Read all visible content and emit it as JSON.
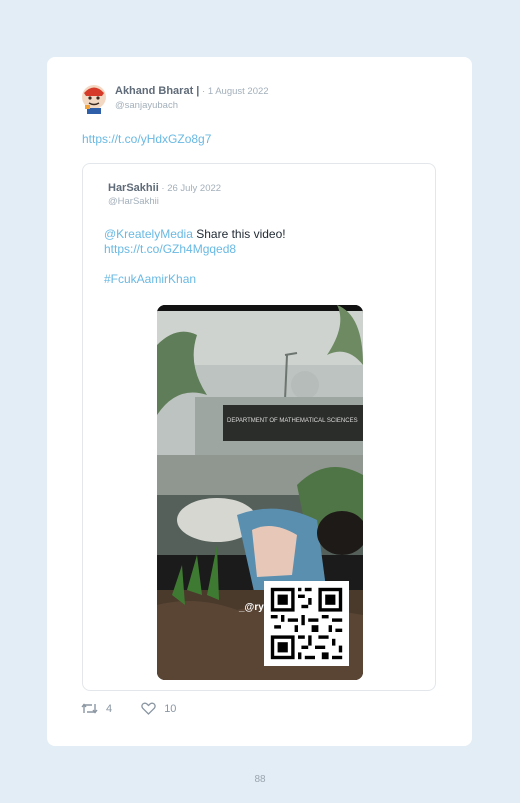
{
  "tweet": {
    "author_name": "Akhand Bharat |",
    "date": " · 1 August 2022",
    "handle": "@sanjayubach",
    "link": "https://t.co/yHdxGZo8g7"
  },
  "quoted": {
    "author_name": "HarSakhii",
    "date": " · 26 July 2022",
    "handle": "@HarSakhii",
    "mention": "@KreatelyMedia",
    "text": " Share this video!",
    "link": "https://t.co/GZh4Mgqed8",
    "hashtag": "#FcukAamirKhan",
    "video_overlay": "_@ry",
    "sign_text": "DEPARTMENT OF MATHEMATICAL SCIENCES"
  },
  "actions": {
    "retweets": "4",
    "likes": "10"
  },
  "page_number": "88",
  "colors": {
    "background": "#e2edf5",
    "link": "#69b9e3",
    "muted": "#a3afba"
  },
  "icons": [
    "retweet-icon",
    "heart-icon"
  ]
}
